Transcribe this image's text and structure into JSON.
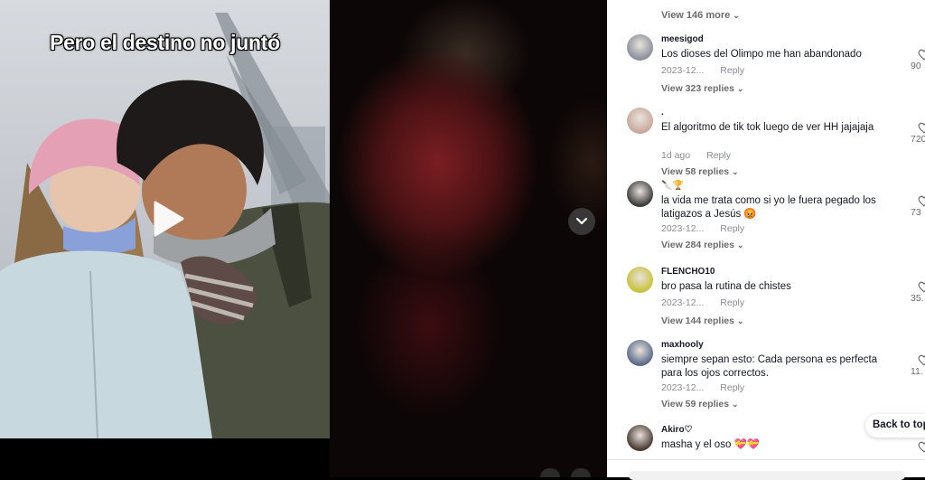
{
  "video": {
    "caption_overlay": "Pero el destino no juntó",
    "play_icon": "play-icon"
  },
  "navigation": {
    "next_icon": "chevron-down-icon"
  },
  "comments_panel": {
    "view_more_top": "View 146 more",
    "comments": [
      {
        "username": "meesigod",
        "text": "Los dioses del Olimpo me han abandonado",
        "date": "2023-12...",
        "reply": "Reply",
        "likes": "90",
        "view_replies": "View 323 replies",
        "avatar_color": "#8a8f9a"
      },
      {
        "username": ".",
        "text": "El algoritmo de tik tok luego de ver HH jajajaja",
        "date": "1d ago",
        "reply": "Reply",
        "likes": "720",
        "view_replies": "View 58 replies",
        "avatar_color": "#c9a89a"
      },
      {
        "username": "🔪🏆",
        "text": "la vida me trata como si yo le fuera pegado los latigazos a Jesús 😡",
        "date": "2023-12...",
        "reply": "Reply",
        "likes": "73",
        "view_replies": "View 284 replies",
        "avatar_color": "#3a3a3a"
      },
      {
        "username": "FLENCHO10",
        "text": "bro pasa la rutina de chistes",
        "date": "2023-12...",
        "reply": "Reply",
        "likes": "35.",
        "view_replies": "View 144 replies",
        "avatar_color": "#c9c23a"
      },
      {
        "username": "maxhooly",
        "text": "siempre sepan esto: Cada persona es perfecta para los ojos correctos.",
        "date": "2023-12...",
        "reply": "Reply",
        "likes": "11.",
        "view_replies": "View 59 replies",
        "avatar_color": "#5a6a8a"
      },
      {
        "username": "Akiro♡",
        "text": "masha y el oso 💝💝",
        "avatar_color": "#4a3a34"
      }
    ]
  },
  "back_to_top": "Back to top"
}
